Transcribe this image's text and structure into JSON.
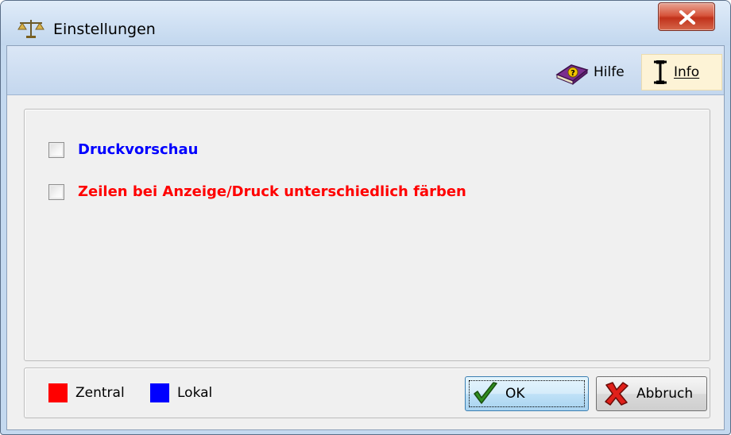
{
  "window": {
    "title": "Einstellungen",
    "app_icon": "scales-icon",
    "close_icon": "close-icon"
  },
  "toolbar": {
    "help_label": "Hilfe",
    "help_icon": "help-book-icon",
    "info_label": "Info",
    "info_icon": "cursor-info-icon"
  },
  "options": [
    {
      "label": "Druckvorschau",
      "checked": false,
      "color": "#0000ff"
    },
    {
      "label": "Zeilen bei Anzeige/Druck unterschiedlich färben",
      "checked": false,
      "color": "#ff0000"
    }
  ],
  "legend": [
    {
      "label": "Zentral",
      "color": "#ff0000"
    },
    {
      "label": "Lokal",
      "color": "#0000ff"
    }
  ],
  "buttons": {
    "ok_label": "OK",
    "ok_icon": "checkmark-icon",
    "cancel_label": "Abbruch",
    "cancel_icon": "cross-icon"
  }
}
